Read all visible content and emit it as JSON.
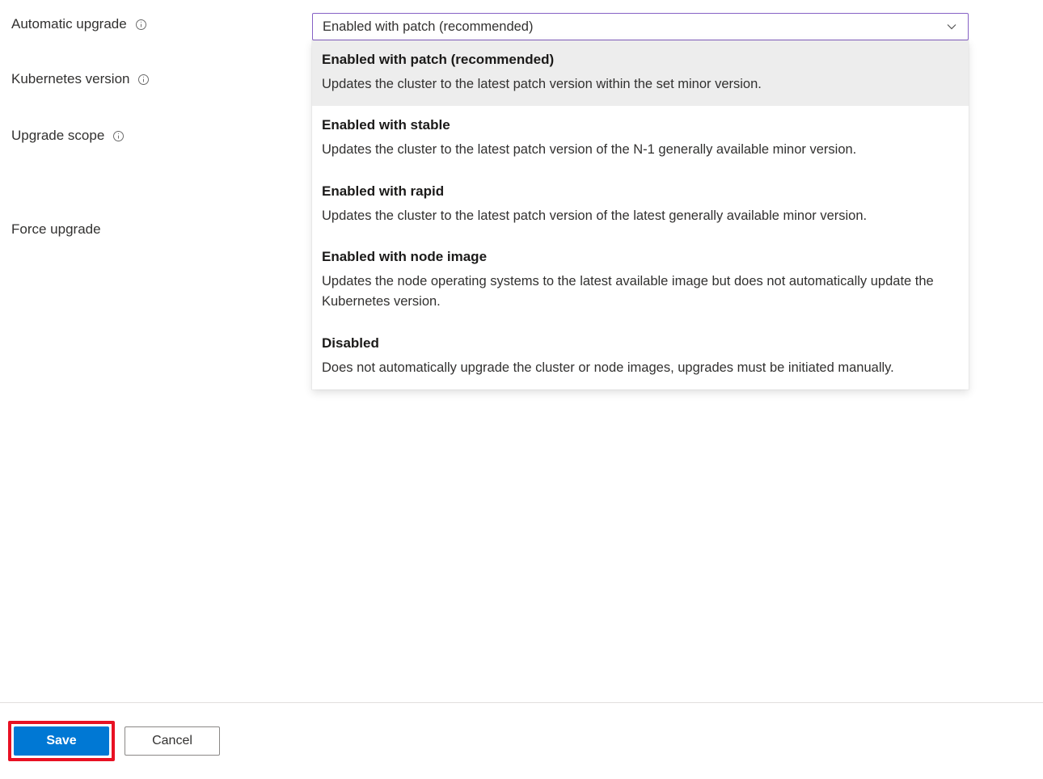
{
  "form": {
    "automatic_upgrade_label": "Automatic upgrade",
    "kubernetes_version_label": "Kubernetes version",
    "upgrade_scope_label": "Upgrade scope",
    "force_upgrade_label": "Force upgrade"
  },
  "dropdown": {
    "selected": "Enabled with patch (recommended)",
    "options": [
      {
        "title": "Enabled with patch (recommended)",
        "desc": "Updates the cluster to the latest patch version within the set minor version."
      },
      {
        "title": "Enabled with stable",
        "desc": "Updates the cluster to the latest patch version of the N-1 generally available minor version."
      },
      {
        "title": "Enabled with rapid",
        "desc": "Updates the cluster to the latest patch version of the latest generally available minor version."
      },
      {
        "title": "Enabled with node image",
        "desc": "Updates the node operating systems to the latest available image but does not automatically update the Kubernetes version."
      },
      {
        "title": "Disabled",
        "desc": "Does not automatically upgrade the cluster or node images, upgrades must be initiated manually."
      }
    ]
  },
  "footer": {
    "save_label": "Save",
    "cancel_label": "Cancel"
  }
}
